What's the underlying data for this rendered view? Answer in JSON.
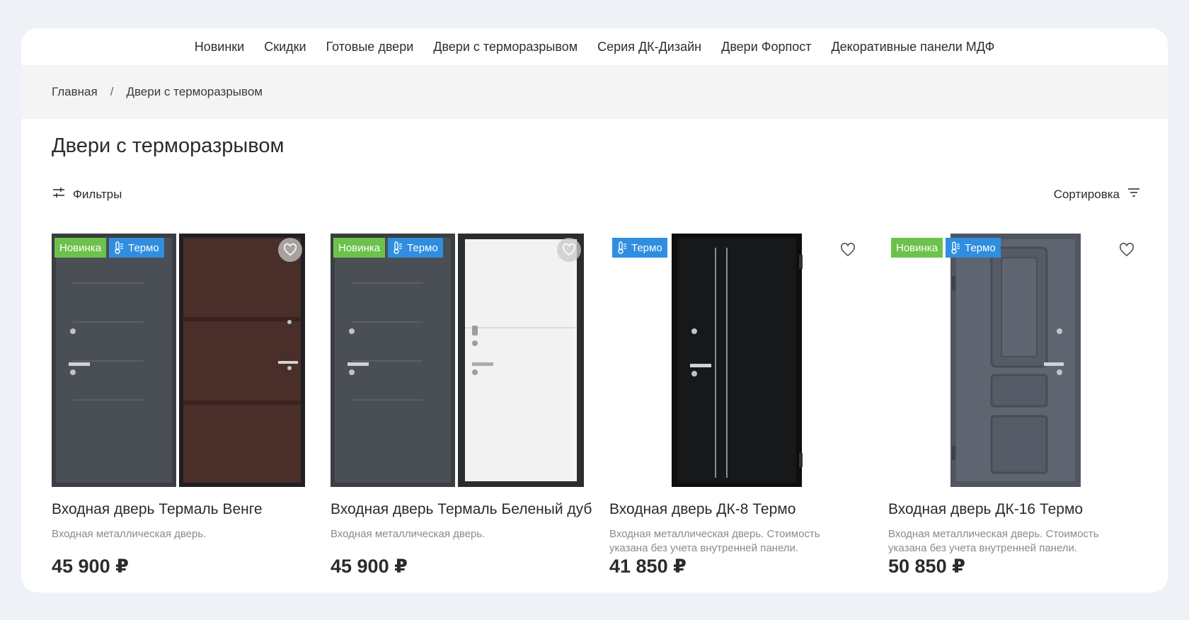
{
  "nav": {
    "items": [
      "Новинки",
      "Скидки",
      "Готовые двери",
      "Двери с терморазрывом",
      "Серия ДК-Дизайн",
      "Двери Форпост",
      "Декоративные панели МДФ"
    ]
  },
  "breadcrumb": {
    "home": "Главная",
    "separator": "/",
    "current": "Двери с терморазрывом"
  },
  "page": {
    "title": "Двери с терморазрывом",
    "filters_label": "Фильтры",
    "sort_label": "Сортировка"
  },
  "badges": {
    "new": "Новинка",
    "thermo": "Термо"
  },
  "products": [
    {
      "name": "Входная дверь Термаль Венге",
      "description": "Входная металлическая дверь.",
      "price": "45 900 ₽",
      "is_new": true,
      "is_thermo": true,
      "image_type": "pair",
      "inner_panel": "wenge"
    },
    {
      "name": "Входная дверь Термаль Беленый дуб",
      "description": "Входная металлическая дверь.",
      "price": "45 900 ₽",
      "is_new": true,
      "is_thermo": true,
      "image_type": "pair",
      "inner_panel": "white-oak"
    },
    {
      "name": "Входная дверь ДК-8 Термо",
      "description": "Входная металлическая дверь. Стоимость указана без учета внутренней панели.",
      "price": "41 850 ₽",
      "is_new": false,
      "is_thermo": true,
      "image_type": "single",
      "door_style": "black-stripes"
    },
    {
      "name": "Входная дверь ДК-16 Термо",
      "description": "Входная металлическая дверь. Стоимость указана без учета внутренней панели.",
      "price": "50 850 ₽",
      "is_new": true,
      "is_thermo": true,
      "image_type": "single",
      "door_style": "grey-panels"
    }
  ],
  "colors": {
    "page_bg": "#eef1f6",
    "badge_new": "#6cc24a",
    "badge_thermo": "#2f8ee0",
    "breadcrumb_bg": "#f4f4f5"
  }
}
